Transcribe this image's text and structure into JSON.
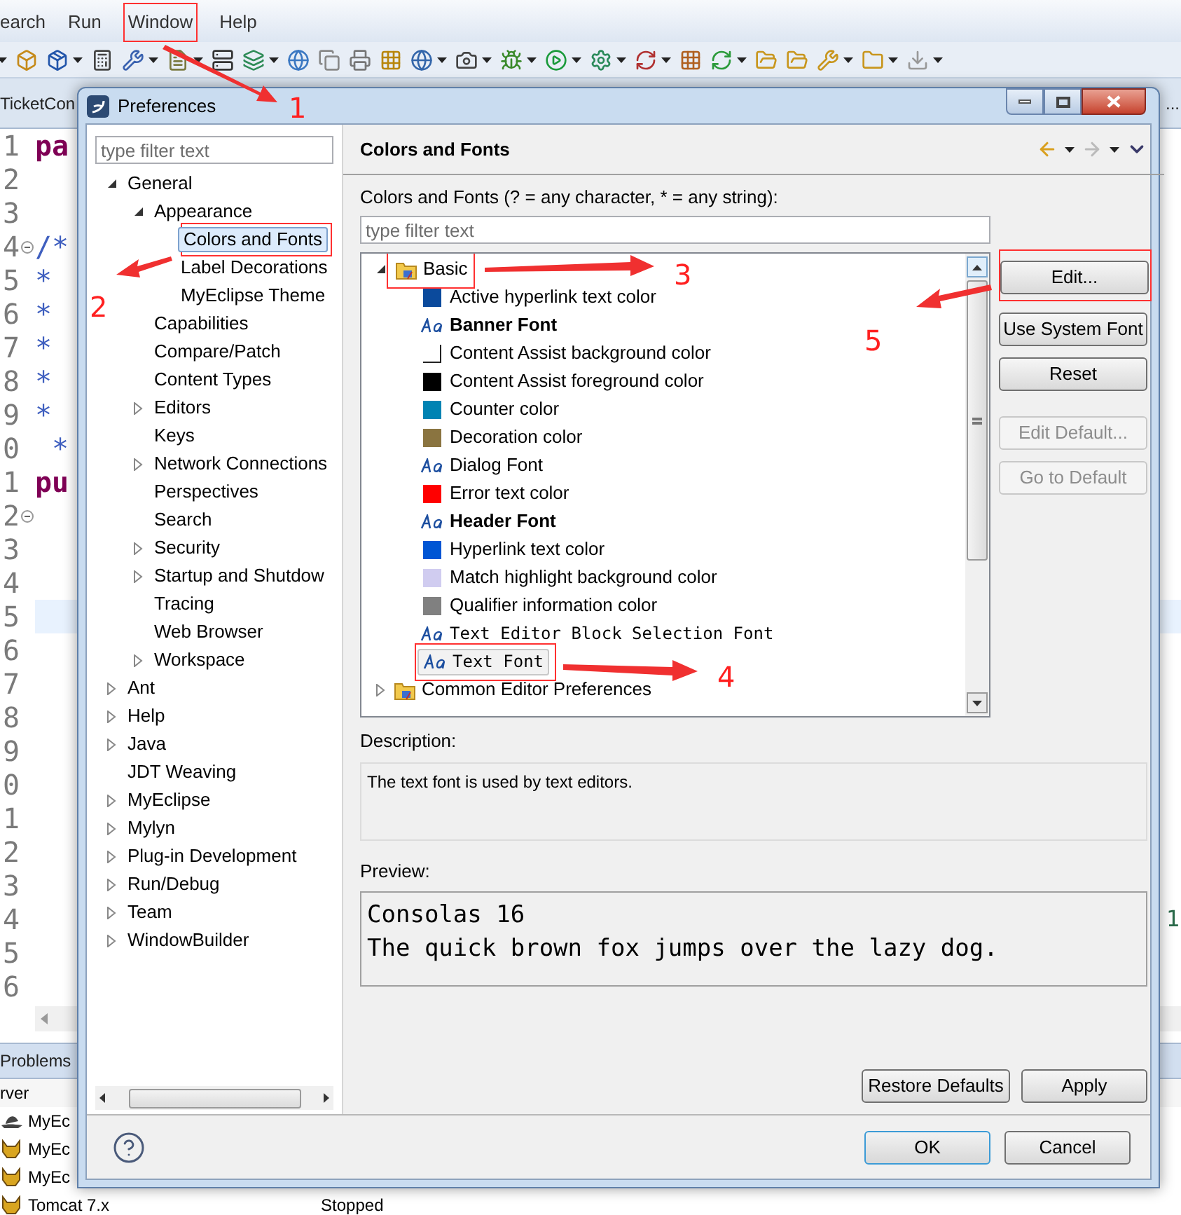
{
  "ide": {
    "menu": [
      {
        "label": "earch",
        "marked": false
      },
      {
        "label": "Run",
        "marked": false
      },
      {
        "label": "Window",
        "marked": true
      },
      {
        "label": "Help",
        "marked": false
      }
    ],
    "tabs": [
      {
        "label": "TicketCon"
      },
      {
        "label": "..."
      }
    ],
    "lines": [
      {
        "number": "1",
        "code": "pa",
        "kind": "keyword",
        "fold": false,
        "current": false
      },
      {
        "number": "2",
        "fold": false,
        "current": false
      },
      {
        "number": "3",
        "fold": false,
        "current": false
      },
      {
        "number": "4",
        "code": "/*",
        "kind": "comment",
        "fold": true,
        "current": false
      },
      {
        "number": "5",
        "code": "*",
        "kind": "comment",
        "fold": false,
        "current": false
      },
      {
        "number": "6",
        "code": "*",
        "kind": "comment",
        "fold": false,
        "current": false
      },
      {
        "number": "7",
        "code": "*",
        "kind": "comment",
        "fold": false,
        "current": false
      },
      {
        "number": "8",
        "code": "*",
        "kind": "comment",
        "fold": false,
        "current": false
      },
      {
        "number": "9",
        "code": "*",
        "kind": "comment",
        "fold": false,
        "current": false
      },
      {
        "number": "0",
        "code": " *",
        "kind": "comment",
        "fold": false,
        "current": false
      },
      {
        "number": "1",
        "code": "pu",
        "kind": "keyword",
        "fold": false,
        "current": false
      },
      {
        "number": "2",
        "fold": true,
        "current": false
      },
      {
        "number": "3",
        "fold": false,
        "current": false
      },
      {
        "number": "4",
        "fold": false,
        "current": false
      },
      {
        "number": "5",
        "fold": false,
        "current": true
      },
      {
        "number": "6",
        "fold": false,
        "current": false
      },
      {
        "number": "7",
        "fold": false,
        "current": false
      },
      {
        "number": "8",
        "fold": false,
        "current": false
      },
      {
        "number": "9",
        "fold": false,
        "current": false
      },
      {
        "number": "0",
        "fold": false,
        "current": false
      },
      {
        "number": "1",
        "fold": false,
        "current": false
      },
      {
        "number": "2",
        "fold": false,
        "current": false
      },
      {
        "number": "3",
        "fold": false,
        "current": false
      },
      {
        "number": "4",
        "fold": false,
        "current": false,
        "right_code": "1"
      },
      {
        "number": "5",
        "fold": false,
        "current": false
      },
      {
        "number": "6",
        "fold": false,
        "current": false
      }
    ],
    "bottom_tab": "Problems",
    "server_column": "rver",
    "servers": [
      {
        "name": "MyEc",
        "kind": "hat"
      },
      {
        "name": "MyEc",
        "kind": "tomcat"
      },
      {
        "name": "MyEc",
        "kind": "tomcat"
      },
      {
        "name": "Tomcat 7.x",
        "kind": "tomcat",
        "status": "Stopped"
      }
    ]
  },
  "dialog": {
    "title": "Preferences",
    "filter": {
      "placeholder": "type filter text"
    },
    "tree": [
      {
        "label": "General",
        "expanded": true,
        "selected": false,
        "marked": false,
        "children": [
          {
            "label": "Appearance",
            "expanded": true,
            "selected": false,
            "marked": false,
            "children": [
              {
                "label": "Colors and Fonts",
                "selected": true,
                "marked": true
              },
              {
                "label": "Label Decorations",
                "selected": false,
                "marked": false
              },
              {
                "label": "MyEclipse Theme",
                "selected": false,
                "marked": false
              }
            ]
          },
          {
            "label": "Capabilities",
            "selected": false,
            "marked": false
          },
          {
            "label": "Compare/Patch",
            "selected": false,
            "marked": false
          },
          {
            "label": "Content Types",
            "selected": false,
            "marked": false
          },
          {
            "label": "Editors",
            "expanded": false,
            "selected": false,
            "marked": false
          },
          {
            "label": "Keys",
            "selected": false,
            "marked": false
          },
          {
            "label": "Network Connections",
            "expanded": false,
            "selected": false,
            "marked": false
          },
          {
            "label": "Perspectives",
            "selected": false,
            "marked": false
          },
          {
            "label": "Search",
            "selected": false,
            "marked": false
          },
          {
            "label": "Security",
            "expanded": false,
            "selected": false,
            "marked": false
          },
          {
            "label": "Startup and Shutdow",
            "expanded": false,
            "selected": false,
            "marked": false
          },
          {
            "label": "Tracing",
            "selected": false,
            "marked": false
          },
          {
            "label": "Web Browser",
            "selected": false,
            "marked": false
          },
          {
            "label": "Workspace",
            "expanded": false,
            "selected": false,
            "marked": false
          }
        ]
      },
      {
        "label": "Ant",
        "expanded": false,
        "selected": false,
        "marked": false
      },
      {
        "label": "Help",
        "expanded": false,
        "selected": false,
        "marked": false
      },
      {
        "label": "Java",
        "expanded": false,
        "selected": false,
        "marked": false
      },
      {
        "label": "JDT Weaving",
        "selected": false,
        "marked": false
      },
      {
        "label": "MyEclipse",
        "expanded": false,
        "selected": false,
        "marked": false
      },
      {
        "label": "Mylyn",
        "expanded": false,
        "selected": false,
        "marked": false
      },
      {
        "label": "Plug-in Development",
        "expanded": false,
        "selected": false,
        "marked": false
      },
      {
        "label": "Run/Debug",
        "expanded": false,
        "selected": false,
        "marked": false
      },
      {
        "label": "Team",
        "expanded": false,
        "selected": false,
        "marked": false
      },
      {
        "label": "WindowBuilder",
        "expanded": false,
        "selected": false,
        "marked": false
      }
    ],
    "page": {
      "title": "Colors and Fonts",
      "filter_label": "Colors and Fonts (? = any character, * = any string):",
      "filter": {
        "placeholder": "type filter text"
      },
      "items": [
        {
          "label": "Basic",
          "kind": "folder",
          "expanded": true,
          "selected": false,
          "marked": true,
          "children": [
            {
              "label": "Active hyperlink text color",
              "kind": "color",
              "color": "#0b4a9c",
              "selected": false,
              "marked": false
            },
            {
              "label": "Banner Font",
              "kind": "font",
              "bold": true,
              "mono": false,
              "selected": false,
              "marked": false
            },
            {
              "label": "Content Assist background color",
              "kind": "color",
              "color": "#ffffff",
              "selected": false,
              "marked": false
            },
            {
              "label": "Content Assist foreground color",
              "kind": "color",
              "color": "#000000",
              "selected": false,
              "marked": false
            },
            {
              "label": "Counter color",
              "kind": "color",
              "color": "#0083b3",
              "selected": false,
              "marked": false
            },
            {
              "label": "Decoration color",
              "kind": "color",
              "color": "#8a7440",
              "selected": false,
              "marked": false
            },
            {
              "label": "Dialog Font",
              "kind": "font",
              "bold": false,
              "mono": false,
              "selected": false,
              "marked": false
            },
            {
              "label": "Error text color",
              "kind": "color",
              "color": "#ff0000",
              "selected": false,
              "marked": false
            },
            {
              "label": "Header Font",
              "kind": "font",
              "bold": true,
              "mono": false,
              "selected": false,
              "marked": false
            },
            {
              "label": "Hyperlink text color",
              "kind": "color",
              "color": "#0055d4",
              "selected": false,
              "marked": false
            },
            {
              "label": "Match highlight background color",
              "kind": "color",
              "color": "#d0ccf0",
              "selected": false,
              "marked": false
            },
            {
              "label": "Qualifier information color",
              "kind": "color",
              "color": "#808080",
              "selected": false,
              "marked": false
            },
            {
              "label": "Text Editor Block Selection Font",
              "kind": "font",
              "bold": false,
              "mono": true,
              "selected": false,
              "marked": false
            },
            {
              "label": "Text Font",
              "kind": "font",
              "bold": false,
              "mono": true,
              "selected": true,
              "marked": true
            }
          ]
        },
        {
          "label": "Common Editor Preferences",
          "kind": "folder",
          "expanded": false,
          "selected": false,
          "marked": false
        }
      ],
      "buttons": [
        {
          "label": "Edit...",
          "disabled": false,
          "marked": true
        },
        {
          "label": "Use System Font",
          "disabled": false,
          "marked": false
        },
        {
          "label": "Reset",
          "disabled": false,
          "marked": false
        },
        {
          "label": "Edit Default...",
          "disabled": true,
          "marked": false
        },
        {
          "label": "Go to Default",
          "disabled": true,
          "marked": false
        }
      ],
      "description_label": "Description:",
      "description": "The text font is used by text editors.",
      "preview_label": "Preview:",
      "preview": [
        "Consolas 16",
        "The quick brown fox jumps over the lazy dog."
      ],
      "page_buttons": [
        "Restore Defaults",
        "Apply"
      ]
    },
    "buttons": [
      {
        "label": "OK",
        "default": true
      },
      {
        "label": "Cancel",
        "default": false
      }
    ]
  },
  "annotations": [
    {
      "number": "1"
    },
    {
      "number": "2"
    },
    {
      "number": "3"
    },
    {
      "number": "4"
    },
    {
      "number": "5"
    }
  ]
}
